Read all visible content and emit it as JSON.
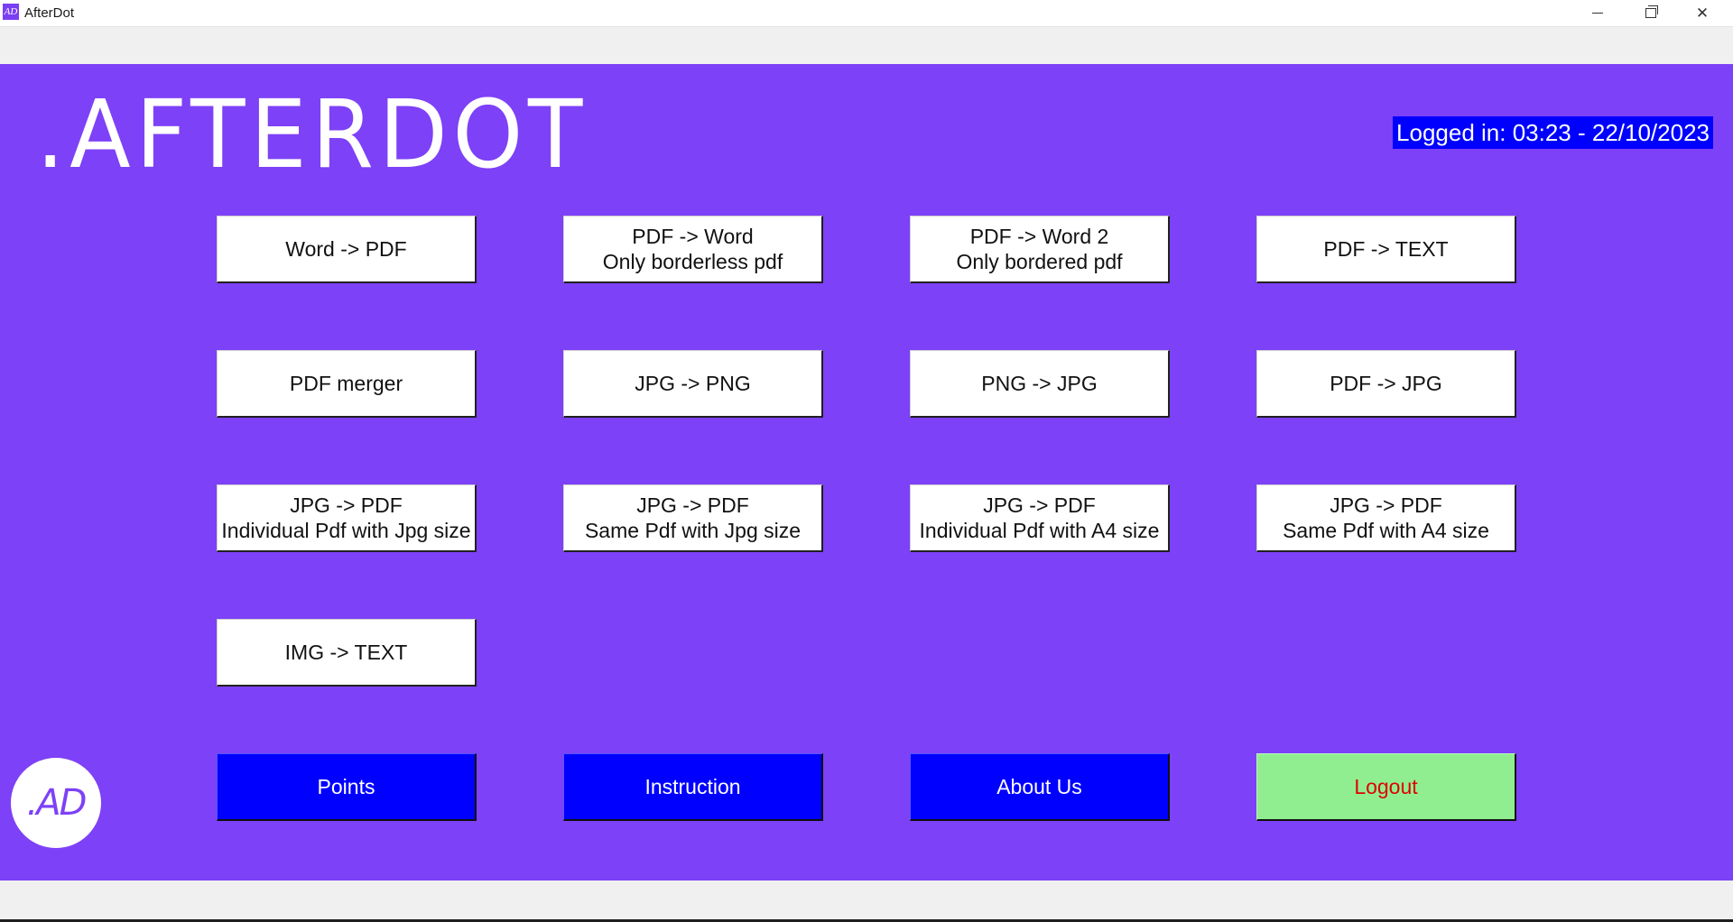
{
  "window": {
    "title": "AfterDot",
    "icon_text": "AD",
    "minimize_glyph": "",
    "close_glyph": "✕"
  },
  "header": {
    "brand": ".AFTERDOT",
    "login_status": "Logged in: 03:23 - 22/10/2023"
  },
  "tools": [
    {
      "label": "Word -> PDF"
    },
    {
      "label": "PDF -> Word\nOnly borderless pdf"
    },
    {
      "label": "PDF -> Word 2\nOnly bordered pdf"
    },
    {
      "label": "PDF -> TEXT"
    },
    {
      "label": "PDF merger"
    },
    {
      "label": "JPG -> PNG"
    },
    {
      "label": "PNG -> JPG"
    },
    {
      "label": "PDF -> JPG"
    },
    {
      "label": "JPG -> PDF\nIndividual Pdf with Jpg size"
    },
    {
      "label": "JPG -> PDF\nSame Pdf with Jpg size"
    },
    {
      "label": "JPG -> PDF\nIndividual Pdf with A4 size"
    },
    {
      "label": "JPG -> PDF\nSame Pdf with A4 size"
    },
    {
      "label": "IMG -> TEXT"
    }
  ],
  "footer_buttons": {
    "points": "Points",
    "instruction": "Instruction",
    "about": "About Us",
    "logout": "Logout"
  },
  "logo": {
    "text": ".AD"
  },
  "colors": {
    "background": "#7d41f7",
    "login_badge": "#0000ff",
    "nav_button": "#0000ff",
    "logout_button": "#90ee90",
    "logout_text": "#e00000"
  }
}
